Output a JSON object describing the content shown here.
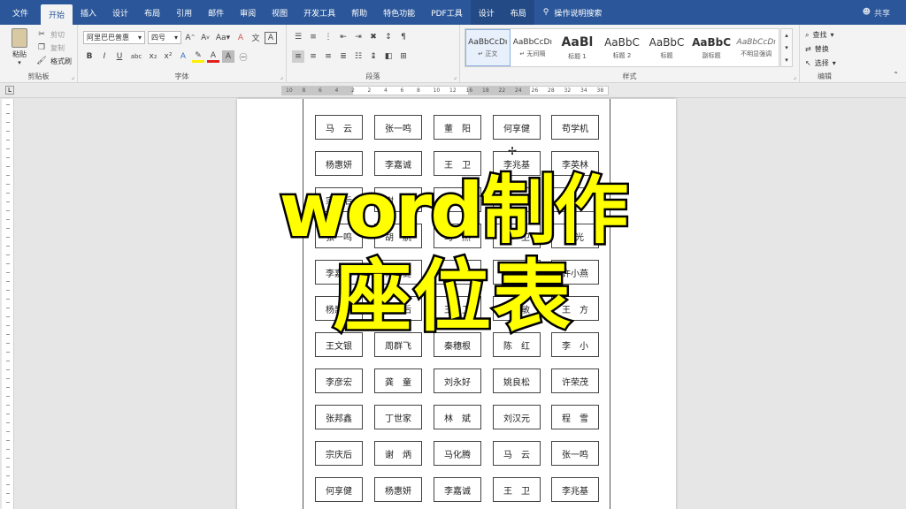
{
  "tabs": [
    {
      "label": "文件",
      "w": 44
    },
    {
      "label": "开始",
      "active": true
    },
    {
      "label": "插入"
    },
    {
      "label": "设计"
    },
    {
      "label": "布局"
    },
    {
      "label": "引用"
    },
    {
      "label": "邮件"
    },
    {
      "label": "审阅"
    },
    {
      "label": "视图"
    },
    {
      "label": "开发工具"
    },
    {
      "label": "帮助"
    },
    {
      "label": "特色功能"
    },
    {
      "label": "PDF工具"
    },
    {
      "label": "设计",
      "ctx": true
    },
    {
      "label": "布局",
      "ctx": true
    }
  ],
  "tell_me": "操作说明搜索",
  "share": "共享",
  "ribbon": {
    "clipboard": {
      "paste": "粘贴",
      "cut": "剪切",
      "copy": "复制",
      "format_painter": "格式刷",
      "label": "剪贴板"
    },
    "font": {
      "name": "阿里巴巴普惠",
      "size": "四号",
      "label": "字体"
    },
    "paragraph": {
      "label": "段落"
    },
    "styles": {
      "label": "样式",
      "items": [
        {
          "preview": "AaBbCcDı",
          "name": "↵ 正文",
          "selected": true
        },
        {
          "preview": "AaBbCcDı",
          "name": "↵ 无间隔"
        },
        {
          "preview": "AaBl",
          "name": "标题 1",
          "big": true
        },
        {
          "preview": "AaBbC",
          "name": "标题 2"
        },
        {
          "preview": "AaBbC",
          "name": "标题"
        },
        {
          "preview": "AaBbC",
          "name": "副标题"
        },
        {
          "preview": "AaBbCcDı",
          "name": "不明显强调",
          "italic": true
        }
      ]
    },
    "editing": {
      "find": "查找",
      "replace": "替换",
      "select": "选择",
      "label": "编辑"
    }
  },
  "ruler_numbers": [
    "10",
    "8",
    "6",
    "4",
    "2",
    "2",
    "4",
    "6",
    "8",
    "10",
    "12",
    "16",
    "18",
    "22",
    "24",
    "26",
    "28",
    "32",
    "34",
    "38"
  ],
  "seats": [
    [
      "马　云",
      "张一鸣",
      "董　阳",
      "何享健",
      "苟学机"
    ],
    [
      "杨惠妍",
      "李嘉诚",
      "王　卫",
      "李兆基",
      "李英林"
    ],
    [
      "宗庆后",
      "谢　炳",
      "马化腾",
      "马　云",
      "张一鸣"
    ],
    [
      "张一鸣",
      "胡　航",
      "马　然",
      "王　卫",
      "刘光"
    ],
    [
      "李嘉诚",
      "何享健",
      "蔡　然",
      "苗　生",
      "许小燕"
    ],
    [
      "杨惠妍",
      "宗庆后",
      "王　卫",
      "吴　敏",
      "王　方"
    ],
    [
      "王文银",
      "周群飞",
      "秦穗根",
      "陈　红",
      "李　小"
    ],
    [
      "李彦宏",
      "龚　童",
      "刘永好",
      "姚良松",
      "许荣茂"
    ],
    [
      "张邦鑫",
      "丁世家",
      "林　斌",
      "刘汉元",
      "程　雪"
    ],
    [
      "宗庆后",
      "谢　炳",
      "马化腾",
      "马　云",
      "张一鸣"
    ],
    [
      "何享健",
      "杨惠妍",
      "李嘉诚",
      "王　卫",
      "李兆基"
    ]
  ],
  "overlay": {
    "line1": "word制作",
    "line2": "座位表"
  }
}
